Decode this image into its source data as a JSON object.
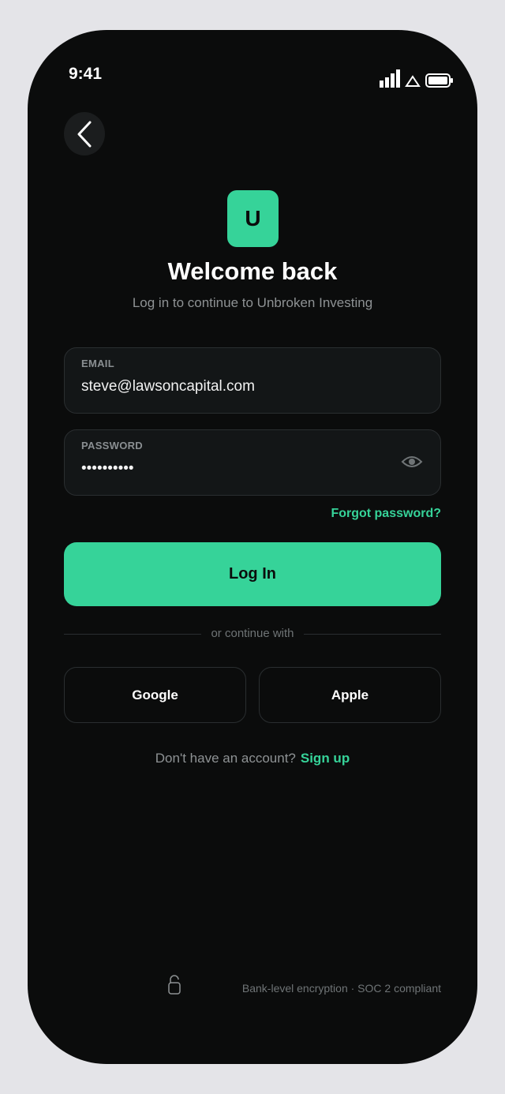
{
  "status_bar": {
    "time": "9:41"
  },
  "brand": {
    "logo_letter": "U",
    "accent_color": "#36d399"
  },
  "header": {
    "title": "Welcome back",
    "subtitle": "Log in to continue to Unbroken Investing"
  },
  "form": {
    "email": {
      "label": "EMAIL",
      "value": "steve@lawsoncapital.com"
    },
    "password": {
      "label": "PASSWORD",
      "value": "••••••••••"
    },
    "forgot_label": "Forgot password?",
    "submit_label": "Log In"
  },
  "divider_text": "or continue with",
  "social": {
    "google_label": "Google",
    "apple_label": "Apple"
  },
  "signup": {
    "question": "Don't have an account?",
    "link": "Sign up"
  },
  "footer": {
    "security_text": "Bank-level encryption · SOC 2 compliant"
  },
  "icons": [
    "signal-icon",
    "wifi-icon",
    "battery-icon",
    "back-chevron-icon",
    "eye-icon",
    "lock-icon"
  ]
}
